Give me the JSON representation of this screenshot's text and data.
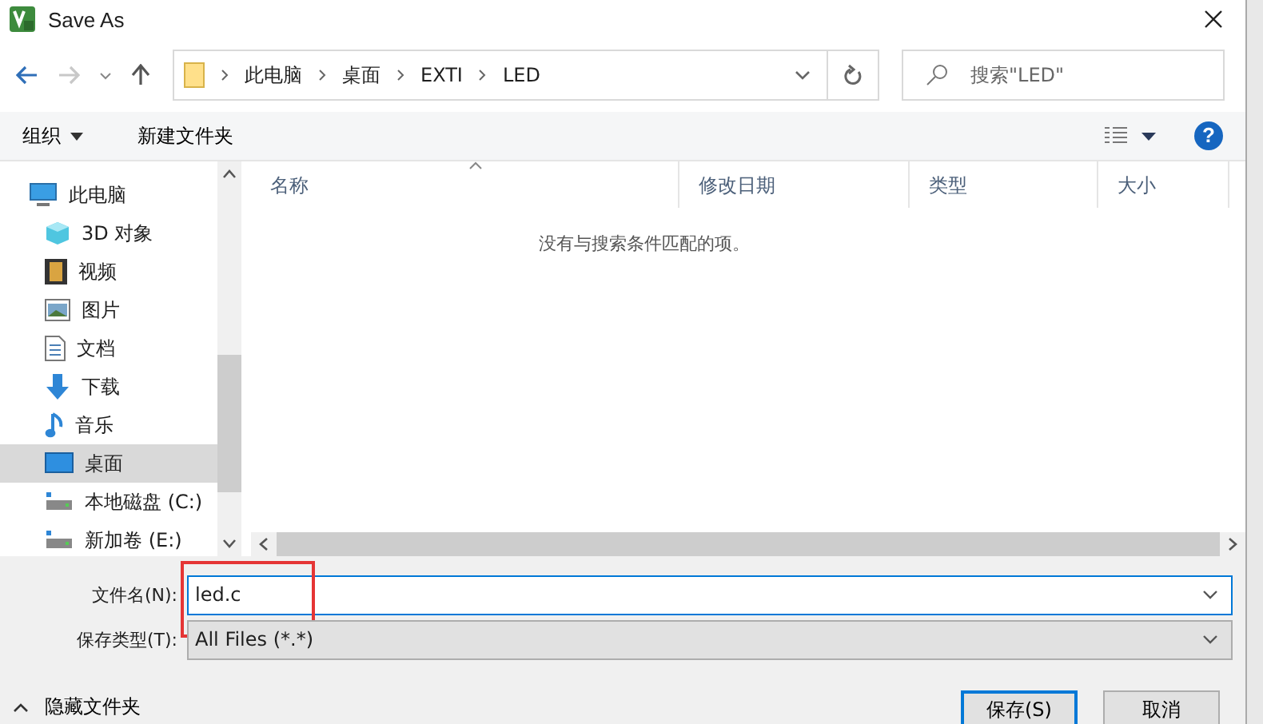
{
  "window": {
    "title": "Save As"
  },
  "nav": {
    "back_enabled": true,
    "forward_enabled": false
  },
  "breadcrumb": [
    "此电脑",
    "桌面",
    "EXTI",
    "LED"
  ],
  "search": {
    "placeholder": "搜索\"LED\""
  },
  "toolbar": {
    "organize": "组织",
    "new_folder": "新建文件夹",
    "help": "?"
  },
  "sidebar": {
    "items": [
      {
        "label": "此电脑",
        "kind": "computer",
        "selected": false,
        "children": [
          {
            "label": "3D 对象",
            "kind": "cube",
            "selected": false
          },
          {
            "label": "视频",
            "kind": "video",
            "selected": false
          },
          {
            "label": "图片",
            "kind": "picture",
            "selected": false
          },
          {
            "label": "文档",
            "kind": "document",
            "selected": false
          },
          {
            "label": "下载",
            "kind": "download",
            "selected": false
          },
          {
            "label": "音乐",
            "kind": "music",
            "selected": false
          },
          {
            "label": "桌面",
            "kind": "desktop",
            "selected": true
          },
          {
            "label": "本地磁盘 (C:)",
            "kind": "drive",
            "selected": false
          },
          {
            "label": "新加卷 (E:)",
            "kind": "drive",
            "selected": false
          }
        ]
      }
    ]
  },
  "table": {
    "columns": [
      {
        "label": "名称",
        "sorted": true
      },
      {
        "label": "修改日期",
        "sorted": false
      },
      {
        "label": "类型",
        "sorted": false
      },
      {
        "label": "大小",
        "sorted": false
      }
    ],
    "empty_message": "没有与搜索条件匹配的项。"
  },
  "file_name": {
    "label": "文件名(N):",
    "value": "led.c",
    "highlighted": true
  },
  "file_type": {
    "label": "保存类型(T):",
    "value": "All Files (*.*)"
  },
  "hide_folders": "隐藏文件夹",
  "buttons": [
    "保存(S)",
    "取消"
  ]
}
